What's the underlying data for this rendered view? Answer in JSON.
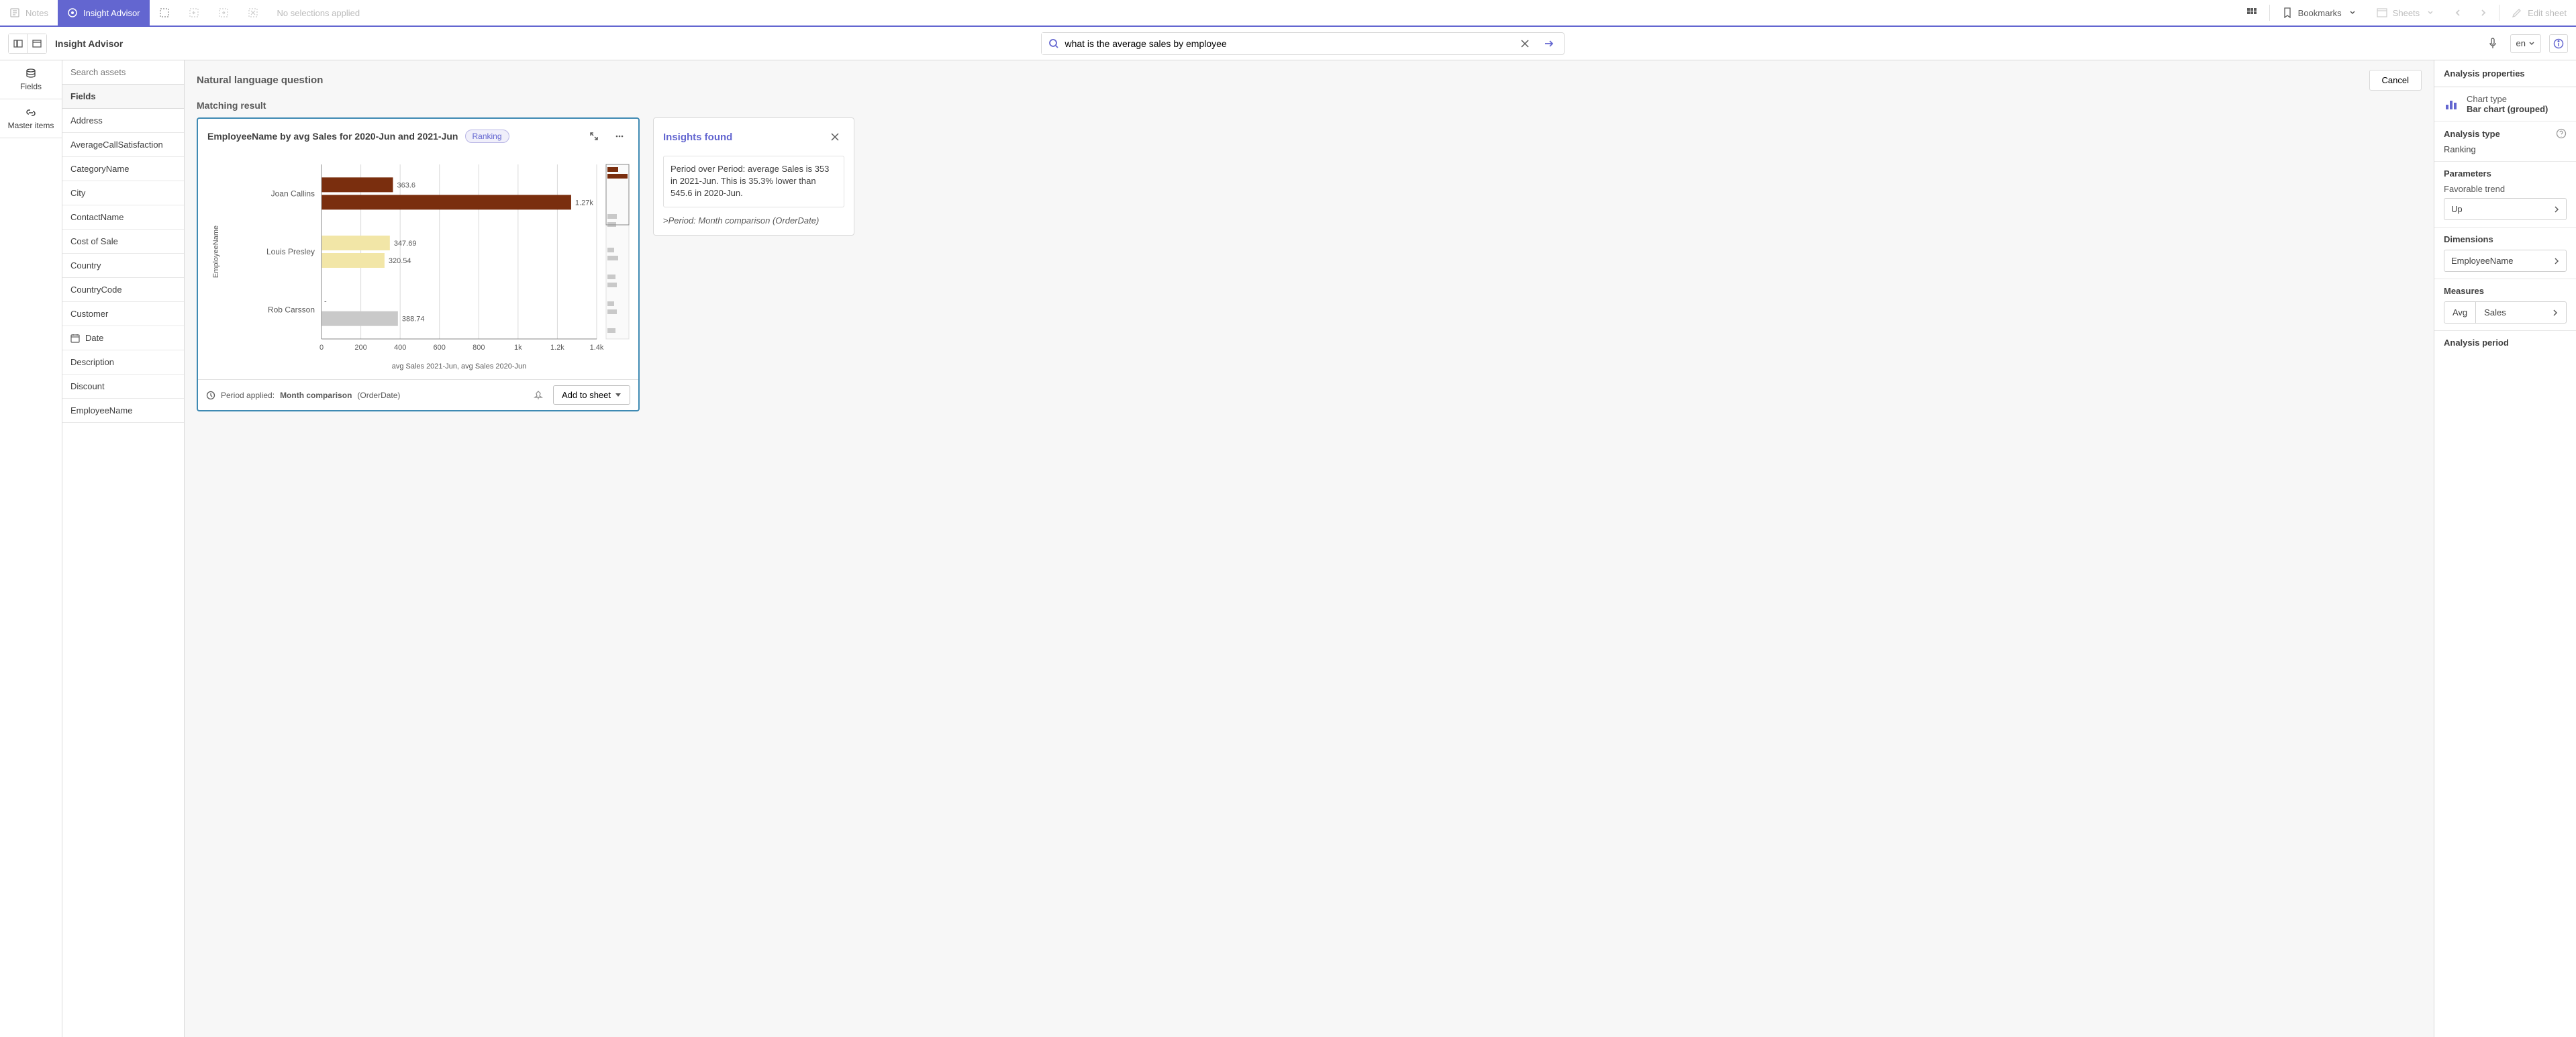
{
  "toolbar": {
    "notes": "Notes",
    "insight_advisor": "Insight Advisor",
    "no_selections": "No selections applied",
    "bookmarks": "Bookmarks",
    "sheets": "Sheets",
    "edit_sheet": "Edit sheet"
  },
  "subbar": {
    "title": "Insight Advisor",
    "search_value": "what is the average sales by employee",
    "lang": "en"
  },
  "rail": {
    "fields": "Fields",
    "master_items": "Master items"
  },
  "assets": {
    "search_placeholder": "Search assets",
    "header": "Fields",
    "items": [
      {
        "label": "Address",
        "icon": null
      },
      {
        "label": "AverageCallSatisfaction",
        "icon": null
      },
      {
        "label": "CategoryName",
        "icon": null
      },
      {
        "label": "City",
        "icon": null
      },
      {
        "label": "ContactName",
        "icon": null
      },
      {
        "label": "Cost of Sale",
        "icon": null
      },
      {
        "label": "Country",
        "icon": null
      },
      {
        "label": "CountryCode",
        "icon": null
      },
      {
        "label": "Customer",
        "icon": null
      },
      {
        "label": "Date",
        "icon": "calendar"
      },
      {
        "label": "Description",
        "icon": null
      },
      {
        "label": "Discount",
        "icon": null
      },
      {
        "label": "EmployeeName",
        "icon": null
      }
    ]
  },
  "center": {
    "nlq_title": "Natural language question",
    "cancel": "Cancel",
    "matching": "Matching result"
  },
  "card": {
    "title": "EmployeeName by avg Sales for 2020-Jun and 2021-Jun",
    "tag": "Ranking",
    "period_label": "Period applied:",
    "period_bold": "Month comparison",
    "period_paren": "(OrderDate)",
    "add": "Add to sheet"
  },
  "insights": {
    "title": "Insights found",
    "text": "Period over Period: average Sales is 353 in 2021-Jun. This is 35.3% lower than 545.6 in 2020-Jun.",
    "caption_prefix": ">",
    "caption": "Period: Month comparison (OrderDate)"
  },
  "props": {
    "header": "Analysis properties",
    "chart_type_label": "Chart type",
    "chart_type_value": "Bar chart (grouped)",
    "analysis_type_label": "Analysis type",
    "analysis_type_value": "Ranking",
    "parameters_label": "Parameters",
    "favorable_trend": "Favorable trend",
    "favorable_value": "Up",
    "dimensions_label": "Dimensions",
    "dimension_value": "EmployeeName",
    "measures_label": "Measures",
    "measure_agg": "Avg",
    "measure_field": "Sales",
    "period_label": "Analysis period"
  },
  "chart_data": {
    "type": "bar",
    "orientation": "horizontal",
    "grouped": true,
    "ylabel": "EmployeeName",
    "xlabel": "avg Sales 2021-Jun, avg Sales 2020-Jun",
    "xlim": [
      0,
      1400
    ],
    "xticks": [
      0,
      200,
      400,
      600,
      800,
      "1k",
      "1.2k",
      "1.4k"
    ],
    "xtick_values": [
      0,
      200,
      400,
      600,
      800,
      1000,
      1200,
      1400
    ],
    "categories": [
      "Joan Callins",
      "Louis Presley",
      "Rob Carsson"
    ],
    "series": [
      {
        "name": "avg Sales 2021-Jun",
        "color": "#7a2e0e",
        "values": [
          363.6,
          347.69,
          null
        ],
        "labels": [
          "363.6",
          "347.69",
          "-"
        ]
      },
      {
        "name": "avg Sales 2020-Jun",
        "color": "#f2e6a7",
        "values": [
          1270,
          320.54,
          388.74
        ],
        "labels": [
          "1.27k",
          "320.54",
          "388.74"
        ]
      }
    ],
    "series_colors_override": {
      "Joan Callins": [
        "#7a2e0e",
        "#7a2e0e"
      ],
      "Louis Presley": [
        "#f2e6a7",
        "#f2e6a7"
      ],
      "Rob Carsson": [
        "#ffffff",
        "#c9c9c9"
      ]
    }
  }
}
